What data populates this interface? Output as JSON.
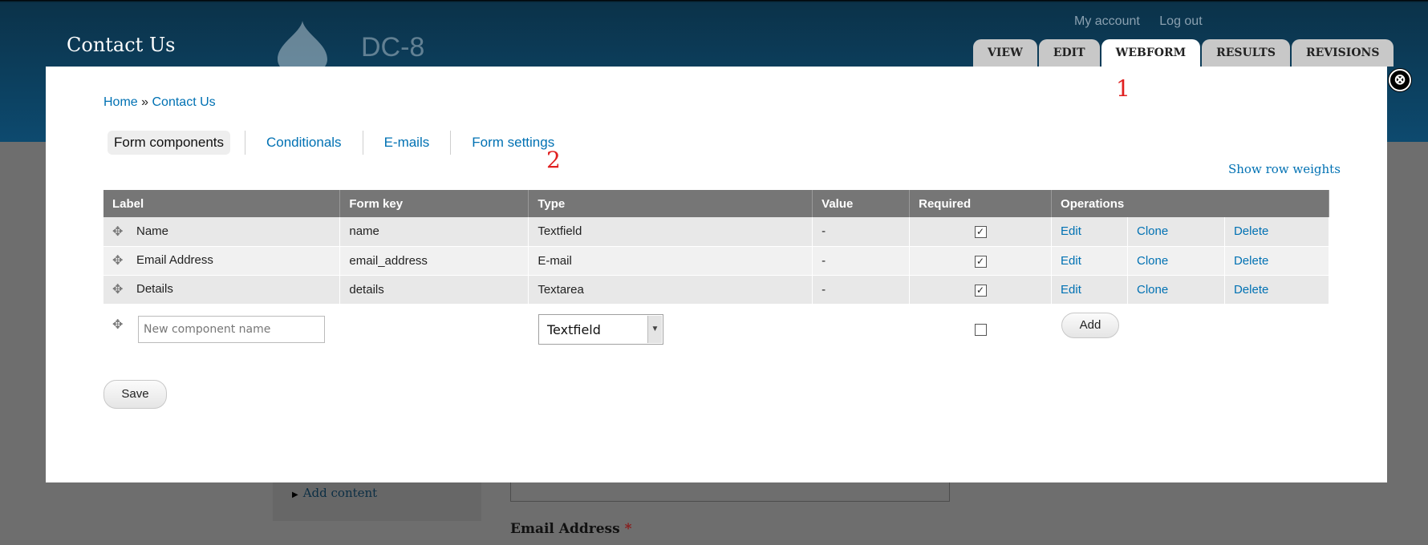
{
  "site": {
    "name": "Contact Us",
    "slogan": "DC-8",
    "user_links": [
      "My account",
      "Log out"
    ],
    "tabs": [
      "VIEW",
      "EDIT",
      "WEBFORM",
      "RESULTS",
      "REVISIONS"
    ],
    "active_tab": "WEBFORM"
  },
  "background": {
    "sidebar_link": "Add content",
    "email_label": "Email Address",
    "required_mark": "*"
  },
  "annotations": [
    "1",
    "2"
  ],
  "modal": {
    "close_icon": "⊗",
    "breadcrumb": {
      "home": "Home",
      "separator": "»",
      "current": "Contact Us"
    },
    "subtabs": [
      "Form components",
      "Conditionals",
      "E-mails",
      "Form settings"
    ],
    "show_row_weights": "Show row weights",
    "table": {
      "headers": [
        "Label",
        "Form key",
        "Type",
        "Value",
        "Required",
        "Operations"
      ],
      "rows": [
        {
          "label": "Name",
          "form_key": "name",
          "type": "Textfield",
          "value": "-",
          "required": true,
          "ops": [
            "Edit",
            "Clone",
            "Delete"
          ]
        },
        {
          "label": "Email Address",
          "form_key": "email_address",
          "type": "E-mail",
          "value": "-",
          "required": true,
          "ops": [
            "Edit",
            "Clone",
            "Delete"
          ]
        },
        {
          "label": "Details",
          "form_key": "details",
          "type": "Textarea",
          "value": "-",
          "required": true,
          "ops": [
            "Edit",
            "Clone",
            "Delete"
          ]
        }
      ]
    },
    "new_component": {
      "placeholder": "New component name",
      "type_selected": "Textfield",
      "required": false,
      "add_label": "Add"
    },
    "save_label": "Save"
  }
}
